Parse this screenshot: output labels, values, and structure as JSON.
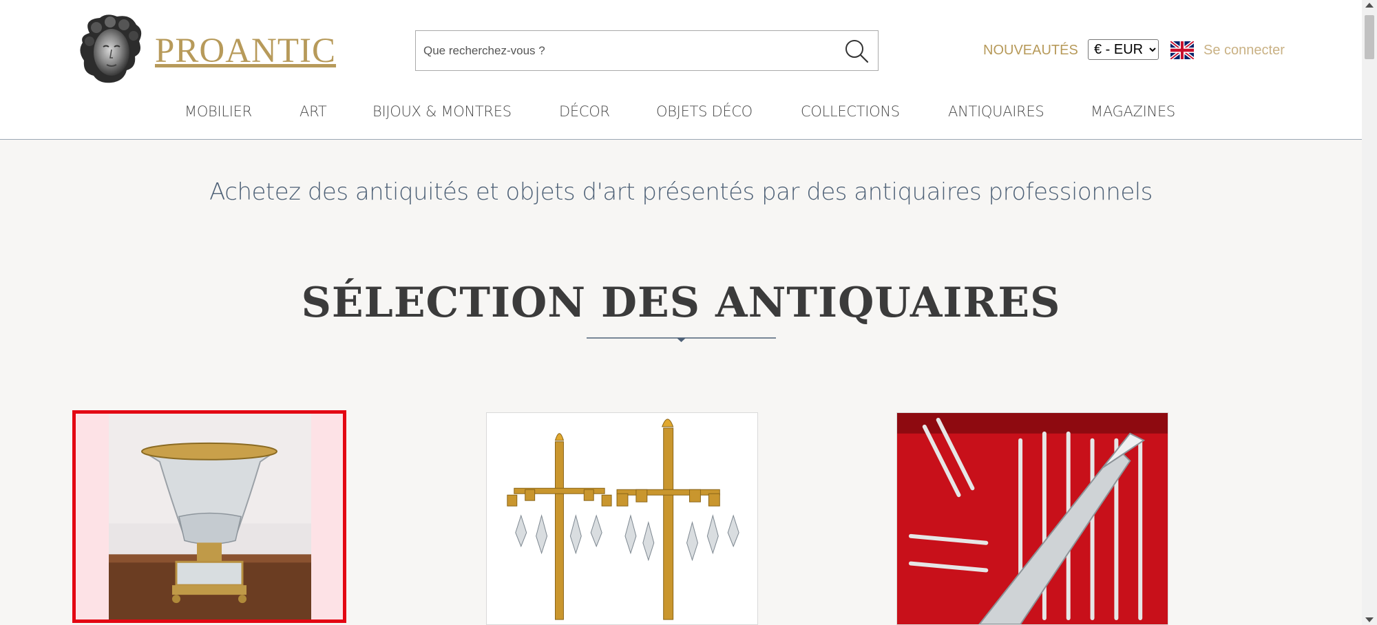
{
  "header": {
    "brand": "PROANTIC",
    "logo_icon": "sculpted-head-logo-icon",
    "search": {
      "placeholder": "Que recherchez-vous ?",
      "icon": "search-icon"
    },
    "nouveautes_label": "NOUVEAUTÉS",
    "currency": {
      "selected": "€ - EUR",
      "options": [
        "€ - EUR"
      ]
    },
    "language_flag_icon": "uk-flag-icon",
    "login_label": "Se connecter"
  },
  "nav": {
    "items": [
      {
        "label": "MOBILIER"
      },
      {
        "label": "ART"
      },
      {
        "label": "BIJOUX & MONTRES"
      },
      {
        "label": "DÉCOR"
      },
      {
        "label": "OBJETS DÉCO"
      },
      {
        "label": "COLLECTIONS"
      },
      {
        "label": "ANTIQUAIRES"
      },
      {
        "label": "MAGAZINES"
      }
    ]
  },
  "main": {
    "tagline": "Achetez des antiquités et objets d'art présentés par des antiquaires professionnels",
    "section_title": "SÉLECTION DES ANTIQUAIRES",
    "products": [
      {
        "image": "crystal-vase-gilt-bronze-image",
        "selected": true
      },
      {
        "image": "gilt-candelabras-crystal-drops-image",
        "selected": false
      },
      {
        "image": "silver-cutlery-set-red-case-image",
        "selected": false
      }
    ]
  },
  "colors": {
    "brand_gold": "#b79a5a",
    "nav_text": "#4a4a4a",
    "tagline_blue": "#4d6076",
    "selection_red": "#e30613",
    "page_bg": "#f7f6f4"
  }
}
